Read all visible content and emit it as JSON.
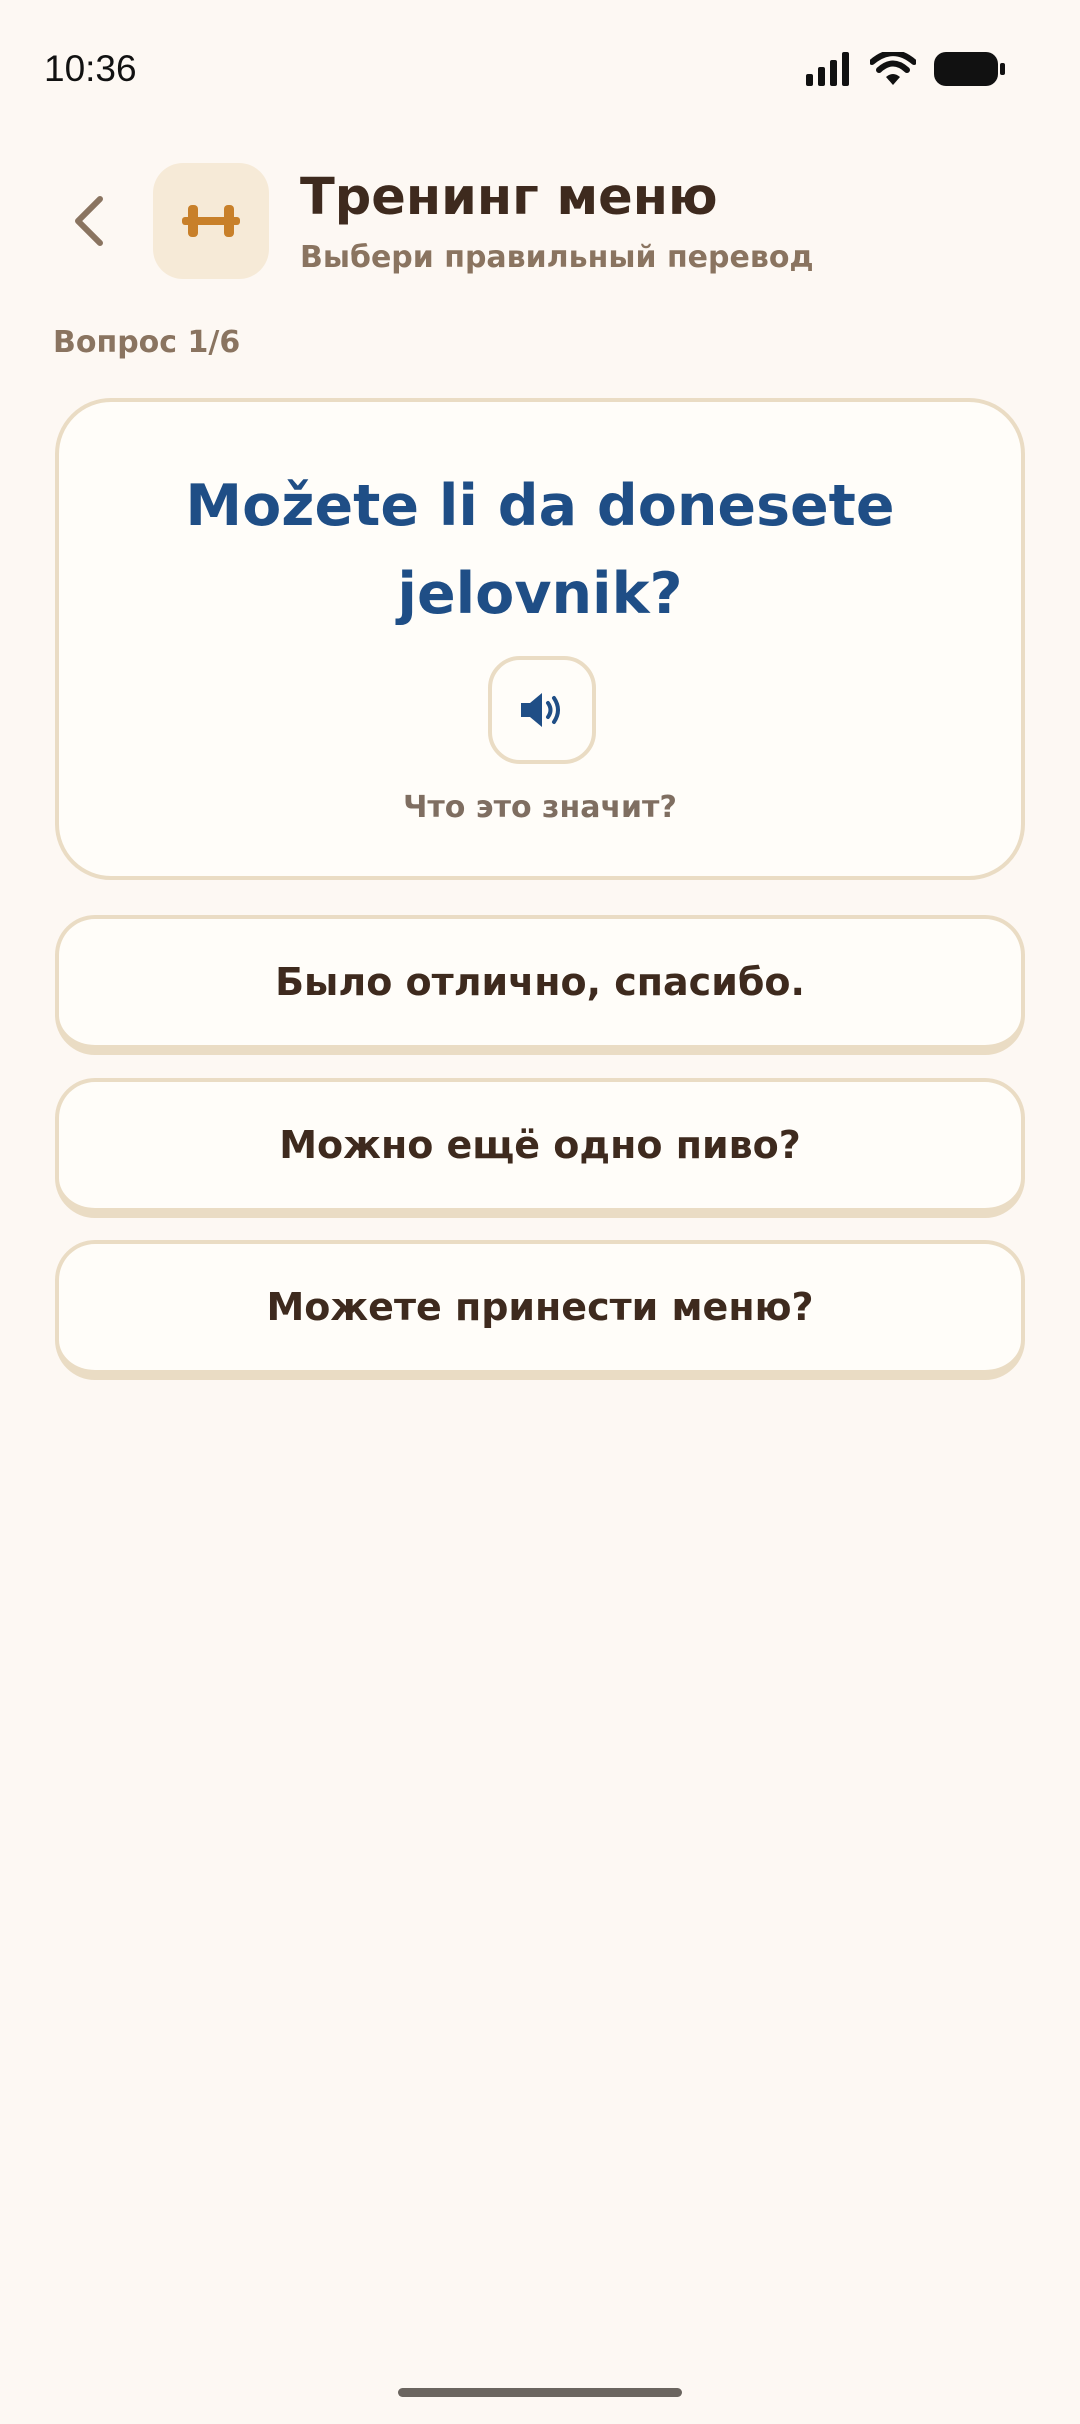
{
  "status_bar": {
    "time": "10:36"
  },
  "header": {
    "title": "Тренинг меню",
    "subtitle": "Выбери правильный перевод",
    "icon": "dumbbell-icon"
  },
  "quiz": {
    "counter": "Вопрос 1/6",
    "phrase": "Možete li da donesete jelovnik?",
    "prompt": "Что это значит?",
    "options": [
      {
        "label": "Было отлично, спасибо."
      },
      {
        "label": "Можно ещё одно пиво?"
      },
      {
        "label": "Можете принести меню?"
      }
    ]
  },
  "colors": {
    "background": "#FDF8F3",
    "accent_blue": "#1F4E86",
    "accent_orange": "#C8802A",
    "border": "#EADCC4",
    "text_dark": "#3E2A1E",
    "text_muted": "#8A7460"
  }
}
